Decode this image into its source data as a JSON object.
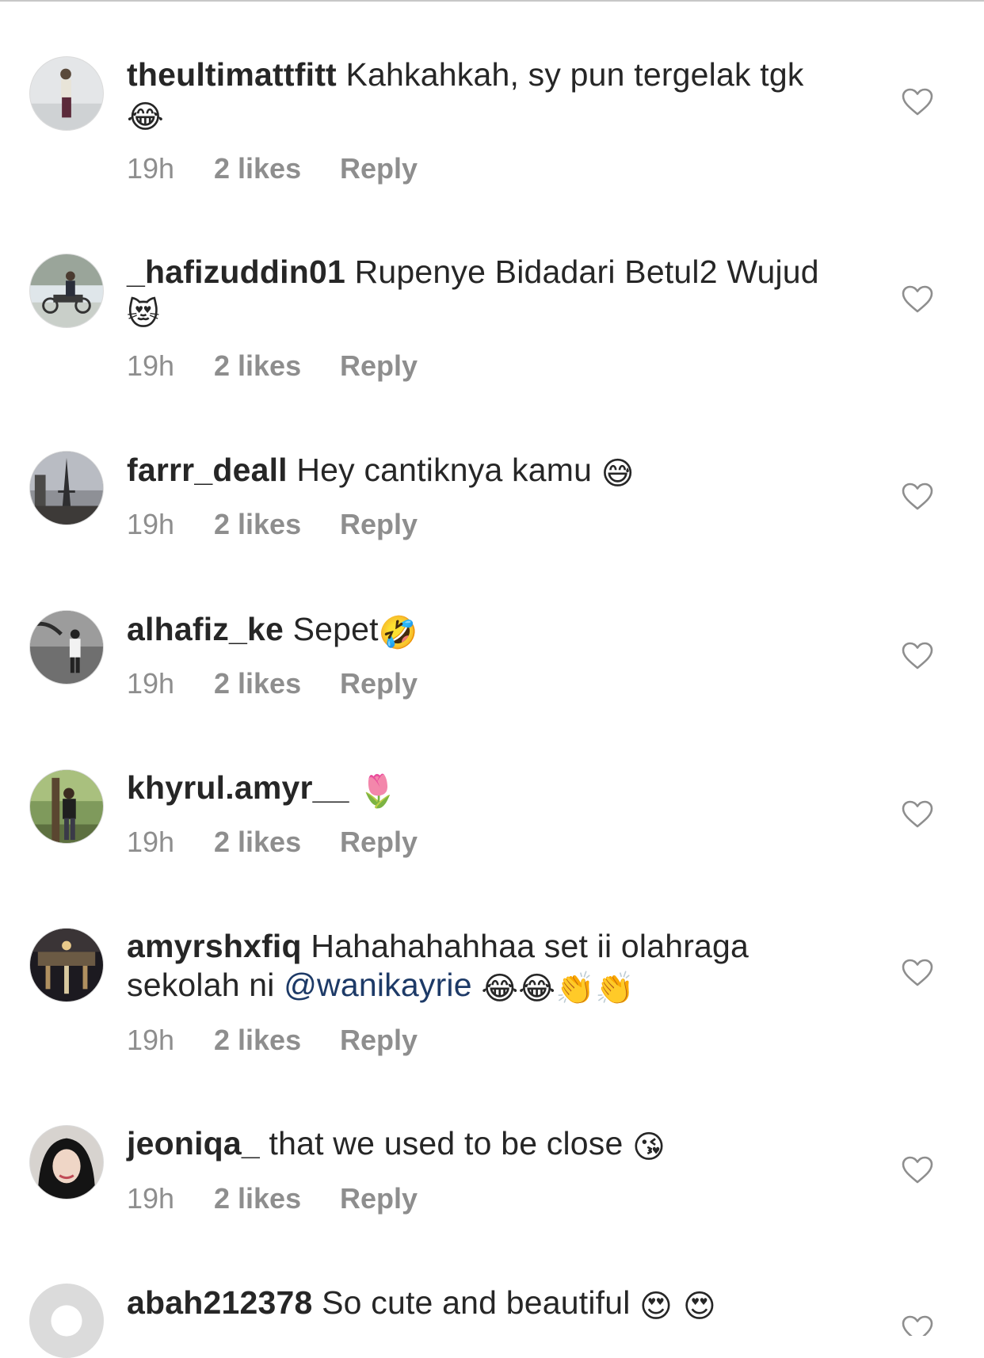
{
  "comments": [
    {
      "username": "theultimattfitt",
      "text": "Kahkahkah, sy pun tergelak tgk",
      "emoji": "😂",
      "time": "19h",
      "likes": "2 likes",
      "reply": "Reply"
    },
    {
      "username": "_hafizuddin01",
      "text": "Rupenye Bidadari Betul2 Wujud",
      "emoji": "😻",
      "time": "19h",
      "likes": "2 likes",
      "reply": "Reply"
    },
    {
      "username": "farrr_deall",
      "text": "Hey cantiknya kamu",
      "emoji": "😅",
      "time": "19h",
      "likes": "2 likes",
      "reply": "Reply"
    },
    {
      "username": "alhafiz_ke",
      "text": "Sepet",
      "emoji": "🤣",
      "time": "19h",
      "likes": "2 likes",
      "reply": "Reply"
    },
    {
      "username": "khyrul.amyr__",
      "text": "",
      "emoji": "🌷",
      "time": "19h",
      "likes": "2 likes",
      "reply": "Reply"
    },
    {
      "username": "amyrshxfiq",
      "text": "Hahahahahhaa set ii olahraga sekolah ni",
      "mention": "@wanikayrie",
      "emoji": "😂😂👏👏",
      "time": "19h",
      "likes": "2 likes",
      "reply": "Reply"
    },
    {
      "username": "jeoniqa_",
      "text": "that we used to be close",
      "emoji": "😘",
      "time": "19h",
      "likes": "2 likes",
      "reply": "Reply"
    },
    {
      "username": "abah212378",
      "text": "So cute and beautiful",
      "emoji": "😍 😍"
    }
  ],
  "icons": {
    "like": "heart-outline-icon",
    "default_avatar": "default-avatar-icon"
  },
  "colors": {
    "text": "#262626",
    "meta": "#8e8e8e",
    "mention": "#1d3a67",
    "heart_stroke": "#8e8e8e"
  }
}
